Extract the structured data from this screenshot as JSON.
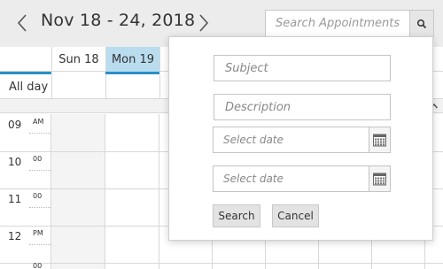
{
  "header": {
    "date_range": "Nov 18 - 24, 2018",
    "search": {
      "placeholder": "Search Appointments"
    }
  },
  "days": [
    "Sun 18",
    "Mon 19"
  ],
  "allday_label": "All day",
  "times": [
    {
      "hour": "09",
      "suffix": "AM"
    },
    {
      "hour": "10",
      "suffix": "00"
    },
    {
      "hour": "11",
      "suffix": "00"
    },
    {
      "hour": "12",
      "suffix": "PM"
    },
    {
      "hour": "",
      "suffix": "00"
    }
  ],
  "popup": {
    "subject_placeholder": "Subject",
    "description_placeholder": "Description",
    "start_date_placeholder": "Select date",
    "end_date_placeholder": "Select date",
    "search_label": "Search",
    "cancel_label": "Cancel"
  },
  "colors": {
    "accent": "#2a8fc5",
    "today_bg": "#b9dcef",
    "header_bg": "#ececec"
  }
}
